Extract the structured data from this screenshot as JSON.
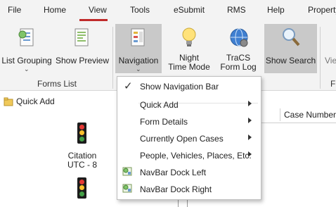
{
  "menubar": {
    "items": [
      "File",
      "Home",
      "View",
      "Tools",
      "eSubmit",
      "RMS",
      "Help",
      "Property"
    ],
    "active": "View"
  },
  "ribbon": {
    "list_grouping": "List Grouping",
    "show_preview": "Show Preview",
    "navigation": "Navigation",
    "night_time_mode_line1": "Night",
    "night_time_mode_line2": "Time Mode",
    "tracs_form_log_line1": "TraCS",
    "tracs_form_log_line2": "Form Log",
    "show_search": "Show Search",
    "cut_off_label": "Vie",
    "group_forms_list": "Forms List",
    "group_cut_off": "F"
  },
  "left_pane": {
    "quick_add": "Quick Add",
    "citation_line1": "Citation",
    "citation_line2": "UTC - 8"
  },
  "grid": {
    "case_number_header": "Case Number"
  },
  "navigation_menu": {
    "items": [
      {
        "label": "Show Navigation Bar",
        "checked": true
      },
      {
        "label": "Quick Add",
        "submenu": true
      },
      {
        "label": "Form Details",
        "submenu": true
      },
      {
        "label": "Currently Open Cases",
        "submenu": true
      },
      {
        "label": "People, Vehicles, Places, Etc.",
        "submenu": true
      },
      {
        "label": "NavBar Dock Left",
        "icon": "navbar-dock-icon"
      },
      {
        "label": "NavBar Dock Right",
        "icon": "navbar-dock-icon"
      }
    ]
  },
  "colors": {
    "accent_red": "#c02a2a",
    "ribbon_bg": "#f3f3f3",
    "pressed_bg": "#c9c9c9"
  }
}
